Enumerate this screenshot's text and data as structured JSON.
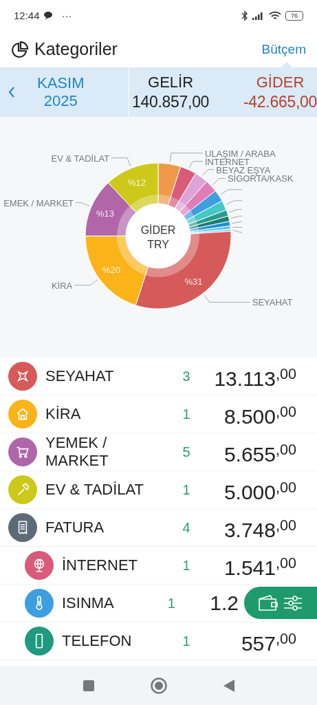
{
  "status_bar": {
    "time": "12:44",
    "dots": "···",
    "battery": "76"
  },
  "header": {
    "title": "Kategoriler",
    "link": "Bütçem"
  },
  "period": {
    "month": "KASIM",
    "year": "2025"
  },
  "totals": [
    {
      "label": "GELİR",
      "amount": "140.857,00",
      "kind": "income"
    },
    {
      "label": "GİDER",
      "amount": "-42.665,00",
      "kind": "expense"
    }
  ],
  "chart": {
    "center_label": [
      "GİDER",
      "TRY"
    ],
    "chart_data": {
      "type": "donut",
      "categories": [
        "ULAŞIM / ARABA",
        "İNTERNET",
        "BEYAZ EŞYA",
        "SİGORTA/KASK",
        null,
        null,
        null,
        null,
        null,
        null,
        null,
        "SEYAHAT",
        "KİRA",
        "EMEK / MARKET",
        "EV & TADİLAT"
      ],
      "values": [
        5,
        3.6,
        3,
        2.8,
        2.6,
        2.2,
        1.4,
        1.2,
        1.0,
        0.7,
        0.5,
        31,
        20,
        13,
        12
      ],
      "colors": [
        "#f0994a",
        "#d95b7a",
        "#dca3d6",
        "#e07db8",
        "#3d9ee0",
        "#44c9c9",
        "#2a9a8a",
        "#1a7f70",
        "#1e8fd8",
        "#5bc0eb",
        "#8fd3f0",
        "#d65a5a",
        "#fbb31a",
        "#b066a8",
        "#cdc91a"
      ],
      "value_labels": [
        null,
        null,
        null,
        null,
        null,
        null,
        null,
        null,
        null,
        null,
        null,
        "%31",
        "%20",
        "%13",
        "%12"
      ]
    }
  },
  "categories": [
    {
      "name": "SEYAHAT",
      "count": "3",
      "amount": "13.113$^{,00}$",
      "color": "#d65a5a"
    },
    {
      "name": "KİRA",
      "count": "1",
      "amount": "8.500$^{,00}$",
      "color": "#fbb31a"
    },
    {
      "name": "YEMEK / MARKET",
      "count": "5",
      "amount": "5.655$^{,00}$",
      "color": "#b066a8"
    },
    {
      "name": "EV & TADİLAT",
      "count": "1",
      "amount": "5.000$^{,00}$",
      "color": "#cdc91a"
    },
    {
      "name": "FATURA",
      "count": "4",
      "amount": "3.748$^{,00}$",
      "color": "#5c6b77",
      "children": [
        {
          "name": "İNTERNET",
          "count": "1",
          "amount": "1.541$^{,00}$",
          "color": "#d95b7a"
        },
        {
          "name": "ISINMA",
          "count": "1",
          "amount": "1.2",
          "color": "#3d9ee0",
          "overlaid": true
        },
        {
          "name": "TELEFON",
          "count": "1",
          "amount": "557$^{,00}$",
          "color": "#1f9a7e"
        }
      ]
    }
  ]
}
